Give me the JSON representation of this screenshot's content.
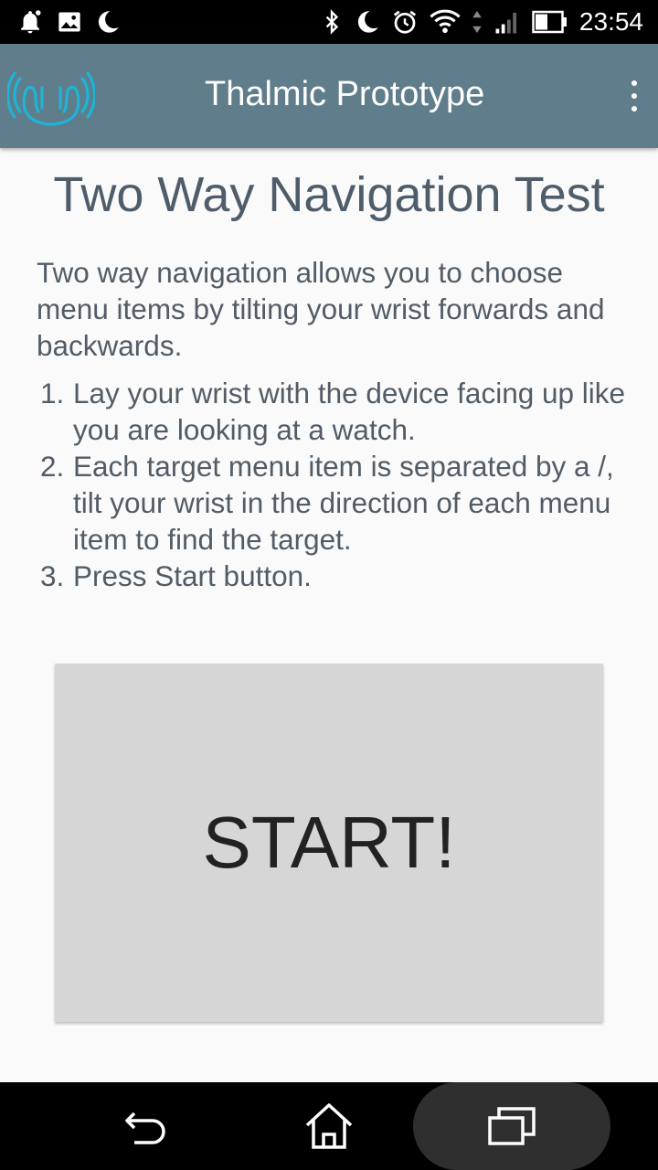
{
  "status_bar": {
    "time": "23:54",
    "left_icons": [
      "notification-bell-icon",
      "image-icon",
      "moon-icon"
    ],
    "right_icons": [
      "bluetooth-icon",
      "moon-icon",
      "alarm-icon",
      "wifi-icon",
      "signal-icon",
      "battery-icon"
    ]
  },
  "app_bar": {
    "title": "Thalmic Prototype",
    "logo_icon": "wrist-signal-icon",
    "overflow_icon": "more-vert-icon"
  },
  "main": {
    "heading": "Two Way Navigation Test",
    "intro": "Two way navigation allows you to choose menu items by tilting your wrist forwards and backwards.",
    "steps": [
      {
        "num": "1.",
        "text": "Lay your wrist with the device facing up like you are looking at a watch."
      },
      {
        "num": "2.",
        "text": "Each target menu item is separated by a /, tilt your wrist in the direction of each menu item to find the target."
      },
      {
        "num": "3.",
        "text": "Press Start button."
      }
    ],
    "start_label": "START!"
  },
  "nav_bar": {
    "back_icon": "back-icon",
    "home_icon": "home-icon",
    "recents_icon": "recents-icon"
  },
  "colors": {
    "app_bar": "#607d8b",
    "heading": "#4f5d6b",
    "body_text": "#525c66",
    "button": "#d6d6d6",
    "logo_accent": "#1eb4d7"
  }
}
